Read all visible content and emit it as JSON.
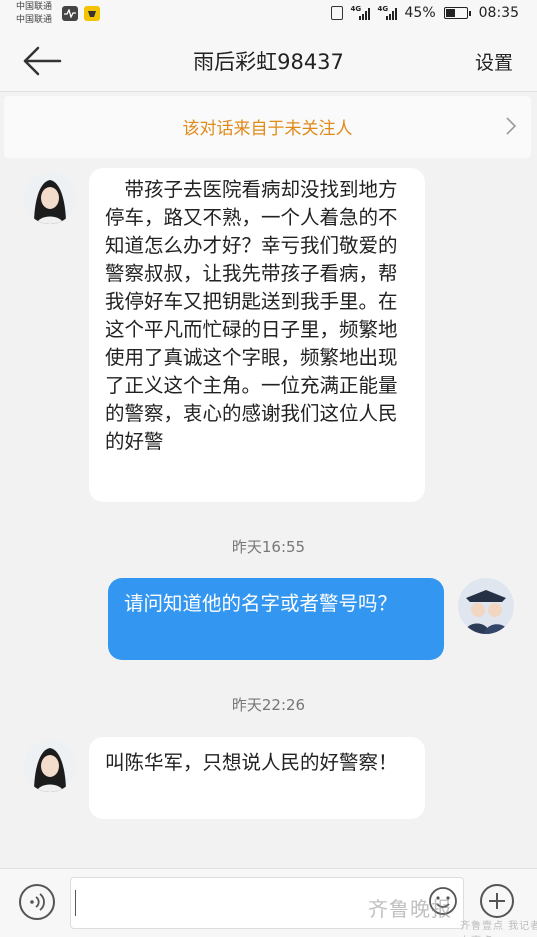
{
  "status_bar": {
    "carrier_1": "中国联通",
    "carrier_2": "中国联通",
    "network_tag_1": "4G",
    "network_tag_2": "4G",
    "battery_percent_text": "45%",
    "battery_level": 0.45,
    "time": "08:35"
  },
  "nav": {
    "title": "雨后彩虹98437",
    "settings_label": "设置"
  },
  "notice": {
    "text": "该对话来自于未关注人"
  },
  "messages": [
    {
      "direction": "incoming",
      "text": "　带孩子去医院看病却没找到地方停车，路又不熟，一个人着急的不知道怎么办才好？幸亏我们敬爱的警察叔叔，让我先带孩子看病，帮我停好车又把钥匙送到我手里。在这个平凡而忙碌的日子里，频繁地使用了真诚这个字眼，频繁地出现了正义这个主角。一位充满正能量的警察，衷心的感谢我们这位人民的好警"
    },
    {
      "timestamp": "昨天16:55"
    },
    {
      "direction": "outgoing",
      "text": "请问知道他的名字或者警号吗？"
    },
    {
      "timestamp": "昨天22:26"
    },
    {
      "direction": "incoming",
      "text": "叫陈华军，只想说人民的好警察！"
    }
  ],
  "input": {
    "placeholder": ""
  },
  "watermark": {
    "text": "齐鲁晚报",
    "sub": "齐鲁壹点 我记者·上壹点"
  },
  "colors": {
    "notice_text": "#e08a1a",
    "outgoing_bubble": "#3396f0",
    "incoming_bubble": "#ffffff",
    "background": "#f2f2f2"
  }
}
